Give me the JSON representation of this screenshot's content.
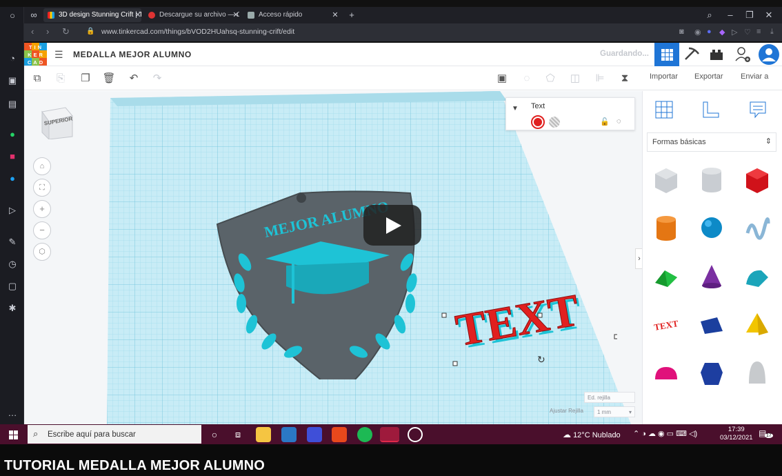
{
  "browser": {
    "tabs": [
      {
        "label": "3D design Stunning Crift | T",
        "active": true
      },
      {
        "label": "Descargue su archivo — Cu",
        "active": false
      },
      {
        "label": "Acceso rápido",
        "active": false
      }
    ],
    "url": "www.tinkercad.com/things/bVOD2HUahsq-stunning-crift/edit"
  },
  "tinkercad": {
    "logo_letters": [
      "TIN",
      "KER",
      "CAD"
    ],
    "project_title": "MEDALLA MEJOR ALUMNO",
    "status": "Guardando...",
    "actions": {
      "import": "Importar",
      "export": "Exportar",
      "send": "Enviar a"
    },
    "view_cube_label": "SUPERIOR",
    "shape_panel": {
      "name": "Text",
      "color_selected": "#e0201f"
    },
    "shape_category": "Formas básicas",
    "grid": {
      "edit_label": "Ed. rejilla",
      "snap_label": "Ajustar Rejilla",
      "snap_value": "1 mm"
    },
    "model": {
      "medal_text": "MEJOR ALUMNO",
      "text_shape": "TEXT"
    }
  },
  "taskbar": {
    "search_placeholder": "Escribe aquí para buscar",
    "weather": "12°C  Nublado",
    "time": "17:39",
    "date": "03/12/2021",
    "notifications": "17"
  },
  "video_title": "TUTORIAL MEDALLA MEJOR ALUMNO",
  "colors": {
    "accent": "#1f75d6",
    "grid": "#bfe6f2",
    "medal": "#5a6369",
    "cap": "#1ec3d6",
    "text_shape": "#e0201f",
    "taskbar": "#4a0f2c"
  }
}
